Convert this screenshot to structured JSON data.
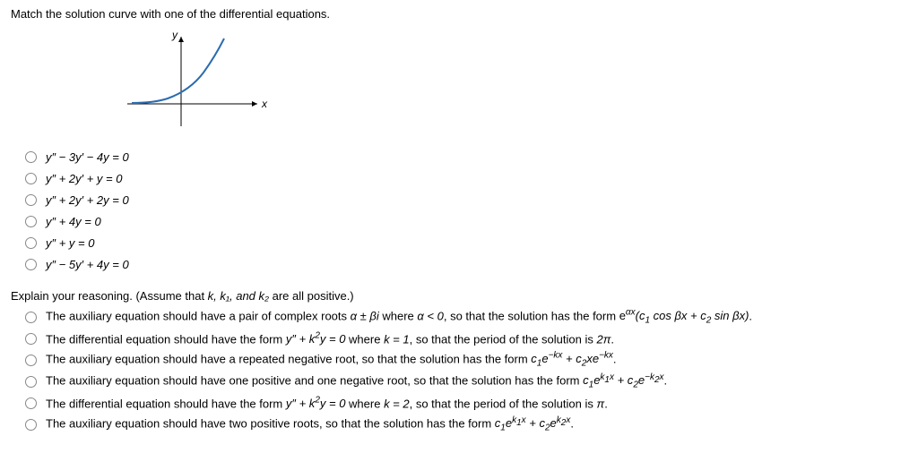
{
  "question": "Match the solution curve with one of the differential equations.",
  "graph": {
    "xlabel": "x",
    "ylabel": "y"
  },
  "options1": {
    "a": "y″ − 3y′ − 4y = 0",
    "b": "y″ + 2y′ + y = 0",
    "c": "y″ + 2y′ + 2y = 0",
    "d": "y″ + 4y = 0",
    "e": "y″ + y = 0",
    "f": "y″ − 5y′ + 4y = 0"
  },
  "explain_prompt_pre": "Explain your reasoning. (Assume that ",
  "explain_prompt_vars": "k,  k₁,  and  k₂",
  "explain_prompt_post": "  are all positive.)",
  "options2": {
    "a_pre": "The auxiliary equation should have a pair of complex roots ",
    "a_mid": "α ± βi",
    "a_where": " where ",
    "a_cond": "α < 0",
    "a_form_pre": ", so that the solution has the form ",
    "a_form": "eᵅˣ(c₁ cos βx + c₂ sin βx)",
    "a_end": ".",
    "b_pre": "The differential equation should have the form ",
    "b_eq": "y″ + k²y = 0",
    "b_mid": " where ",
    "b_k": "k = 1",
    "b_post": ", so that the period of the solution is ",
    "b_period": "2π",
    "b_end": ".",
    "c_pre": "The auxiliary equation should have a repeated negative root, so that the solution has the form ",
    "c_end": ".",
    "d_pre": "The auxiliary equation should have one positive and one negative root, so that the solution has the form ",
    "d_end": ".",
    "e_pre": "The differential equation should have the form ",
    "e_eq": "y″ + k²y = 0",
    "e_mid": " where ",
    "e_k": "k = 2",
    "e_post": ", so that the period of the solution is ",
    "e_period": "π",
    "e_end": ".",
    "f_pre": "The auxiliary equation should have two positive roots, so that the solution has the form ",
    "f_end": "."
  }
}
